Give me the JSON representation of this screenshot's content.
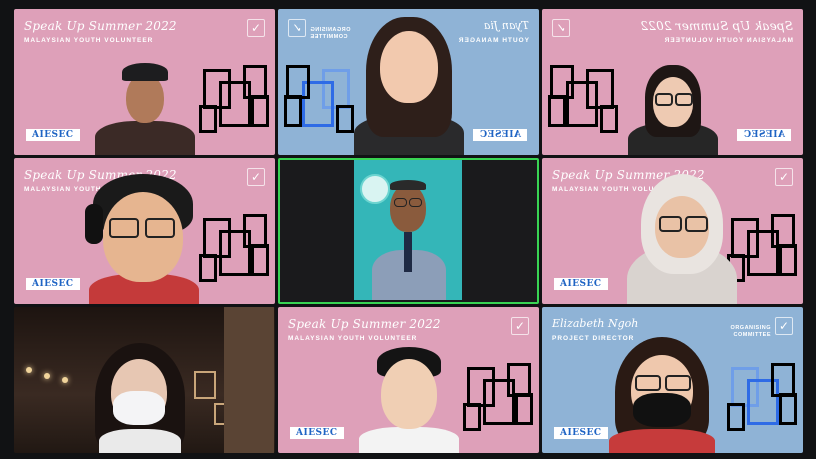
{
  "meeting": {
    "background_event_title": "Speak Up Summer 2022",
    "background_event_subtitle": "MALAYSIAN YOUTH VOLUNTEER",
    "org_logo_text": "AIESEC",
    "org_logo_tail": "///\\\\",
    "committee_text": "ORGANISING COMMITTEE"
  },
  "tiles": [
    {
      "id": "p1",
      "bg": "pink",
      "title": "Speak Up Summer 2022",
      "subtitle": "MALAYSIAN YOUTH VOLUNTEER",
      "aiesec": "AIESEC",
      "frames": "pink"
    },
    {
      "id": "p2",
      "bg": "blue",
      "name": "Tyan Jia",
      "role": "YOUTH MANAGER",
      "org": "ORGANISING COMMITTEE",
      "aiesec": "AIESEC",
      "frames": "blue",
      "mirrored": true
    },
    {
      "id": "p3",
      "bg": "pink",
      "title": "Speak Up Summer 2022",
      "subtitle": "MALAYSIAN YOUTH VOLUNTEER",
      "aiesec": "AIESEC",
      "frames": "pink",
      "mirrored": true
    },
    {
      "id": "p4",
      "bg": "pink",
      "title": "Speak Up Summer 2022",
      "subtitle": "MALAYSIAN YOUTH VOLUNTEER",
      "aiesec": "AIESEC",
      "frames": "pink"
    },
    {
      "id": "p5",
      "bg": "dark",
      "active_speaker": true
    },
    {
      "id": "p6",
      "bg": "pink",
      "title": "Speak Up Summer 2022",
      "subtitle": "MALAYSIAN YOUTH VOLUNTEER",
      "aiesec": "AIESEC",
      "frames": "pink"
    },
    {
      "id": "p7",
      "bg": "dark"
    },
    {
      "id": "p8",
      "bg": "pink",
      "title": "Speak Up Summer 2022",
      "subtitle": "MALAYSIAN YOUTH VOLUNTEER",
      "aiesec": "AIESEC",
      "frames": "pink"
    },
    {
      "id": "p9",
      "bg": "blue",
      "name": "Elizabeth Ngoh",
      "role": "PROJECT DIRECTOR",
      "org": "ORGANISING COMMITTEE",
      "aiesec": "AIESEC",
      "frames": "blue"
    }
  ],
  "colors": {
    "pink_bg": "#dea0b9",
    "blue_bg": "#8fb3d6",
    "active_border": "#39d353",
    "window_bg": "#111214"
  }
}
